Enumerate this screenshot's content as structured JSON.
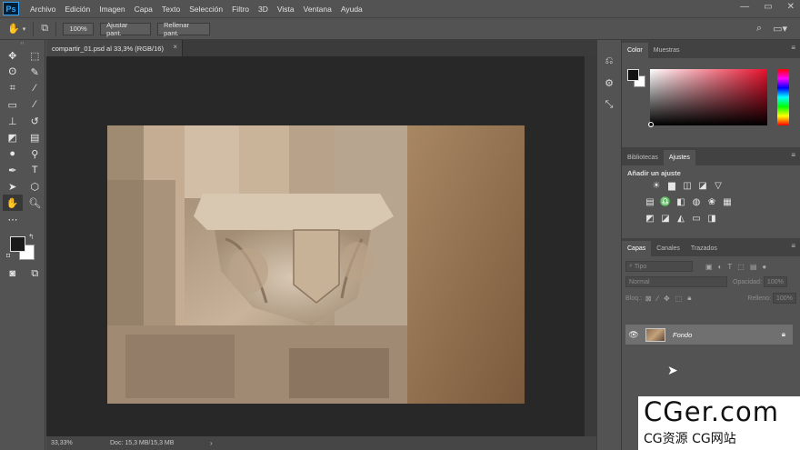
{
  "app": {
    "logo": "Ps"
  },
  "menu": [
    "Archivo",
    "Edición",
    "Imagen",
    "Capa",
    "Texto",
    "Selección",
    "Filtro",
    "3D",
    "Vista",
    "Ventana",
    "Ayuda"
  ],
  "window_controls": {
    "minimize": "—",
    "maximize": "▭",
    "close": "✕"
  },
  "options_bar": {
    "zoom": "100%",
    "fit_button": "Ajustar pant.",
    "fill_button": "Rellenar pant."
  },
  "document": {
    "tab_title": "compartir_01.psd al 33,3% (RGB/16)",
    "tab_close": "×",
    "status_zoom": "33,33%",
    "status_doc": "Doc: 15,3 MB/15,3 MB",
    "status_arrow": "›"
  },
  "panels": {
    "color_tabs": [
      "Color",
      "Muestras"
    ],
    "adjust_tabs": [
      "Bibliotecas",
      "Ajustes"
    ],
    "adjust_title": "Añadir un ajuste",
    "layers_tabs": [
      "Capas",
      "Canales",
      "Trazados"
    ],
    "filter_placeholder": "Tipo",
    "blend_mode": "Normal",
    "opacity_label": "Opacidad:",
    "opacity_value": "100%",
    "lock_label": "Bloq.:",
    "fill_label": "Relleno:",
    "fill_value": "100%",
    "panel_menu": "≡"
  },
  "layers": [
    {
      "name": "Fondo",
      "visible": true,
      "locked": true
    }
  ],
  "colors": {
    "foreground": "#111111",
    "background": "#ffffff",
    "accent": "#31a8ff"
  },
  "watermark": {
    "line1": "CGer.com",
    "line2": "CG资源 CG网站"
  }
}
